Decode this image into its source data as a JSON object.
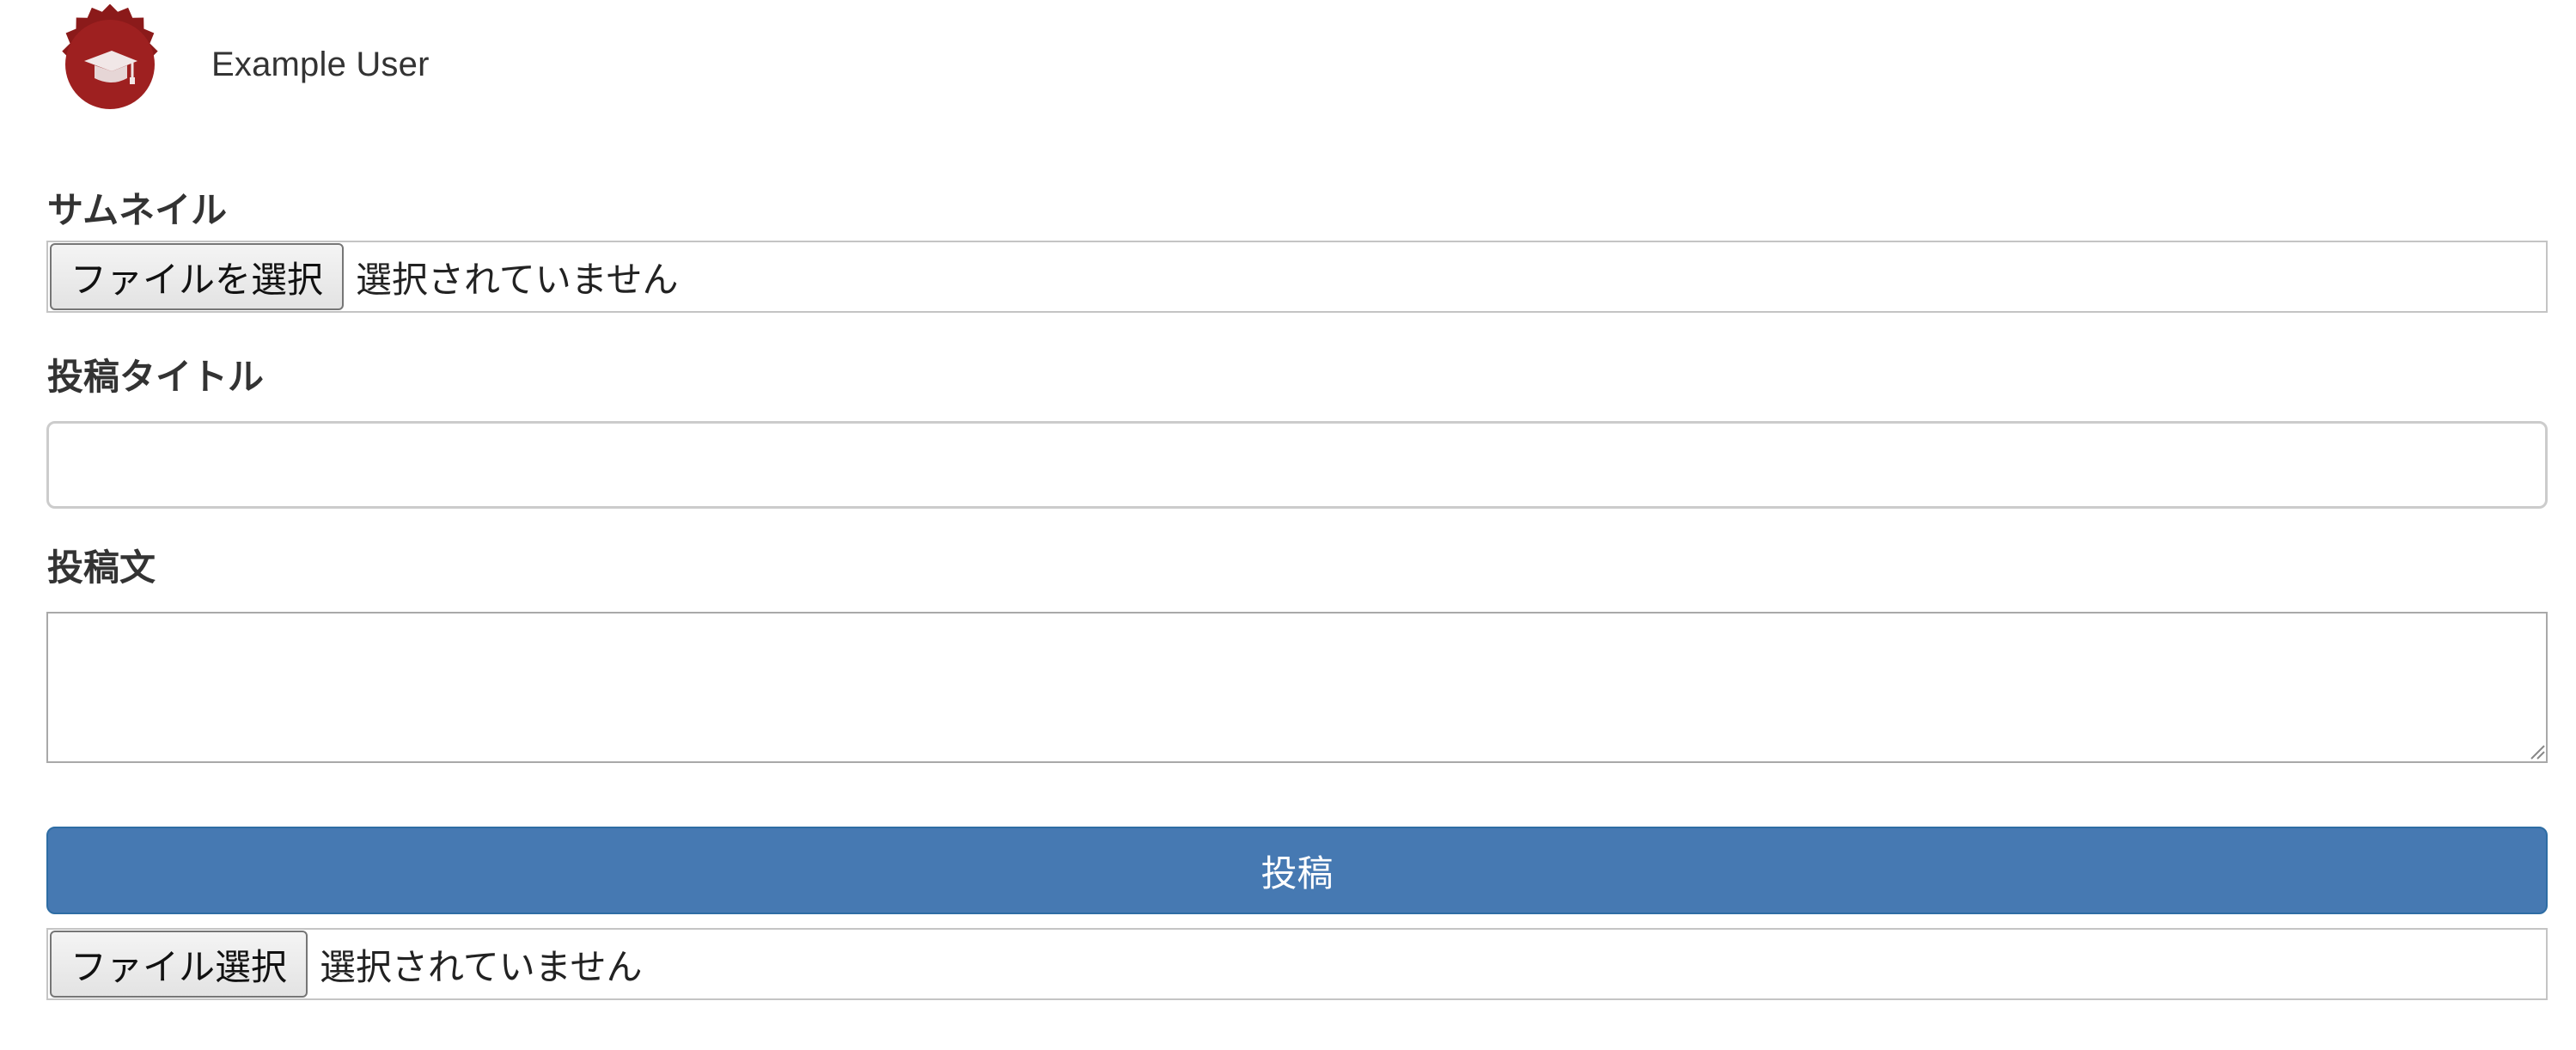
{
  "user": {
    "name": "Example User",
    "avatar_icon": "graduation-cap-badge-icon",
    "avatar_color": "#8b1a1a"
  },
  "form": {
    "thumbnail": {
      "label": "サムネイル",
      "button_label": "ファイルを選択",
      "status": "選択されていません"
    },
    "title": {
      "label": "投稿タイトル",
      "value": "",
      "placeholder": ""
    },
    "body": {
      "label": "投稿文",
      "value": ""
    },
    "submit_label": "投稿",
    "extra_file": {
      "button_label": "ファイル選択",
      "status": "選択されていません"
    }
  },
  "colors": {
    "primary": "#4679b2",
    "text": "#333333",
    "border": "#cccccc"
  }
}
